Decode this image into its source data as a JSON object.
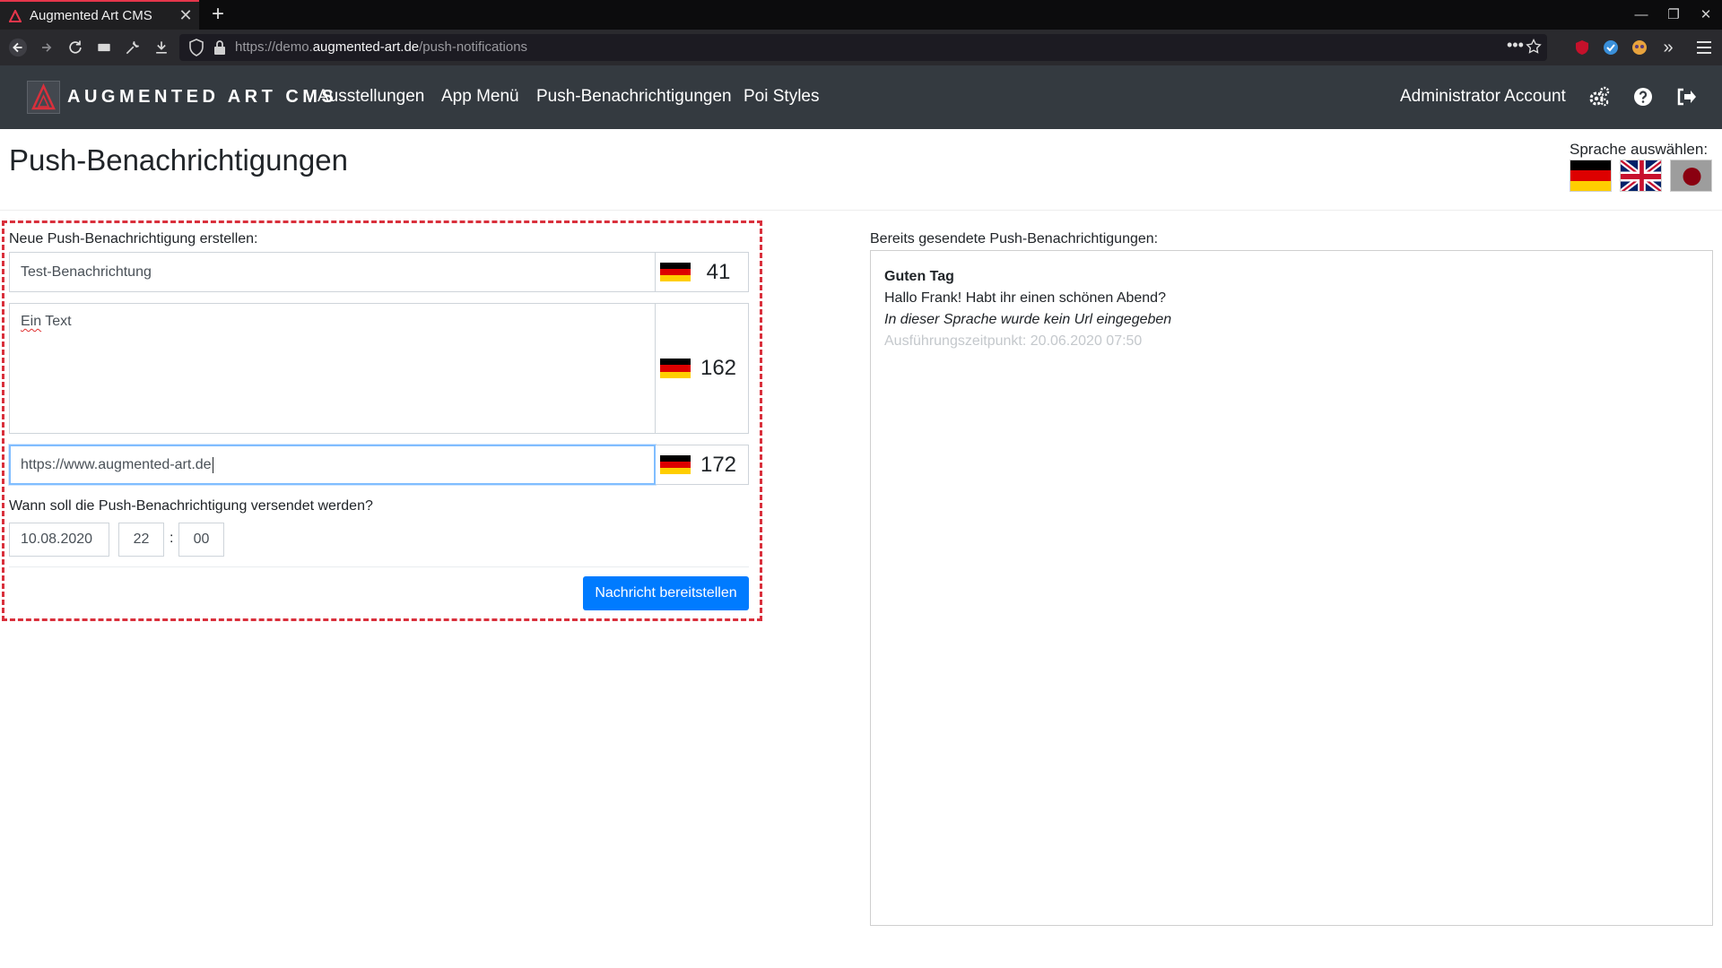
{
  "browser": {
    "tab_title": "Augmented Art CMS",
    "url_prefix": "https://demo.",
    "url_host": "augmented-art.de",
    "url_path": "/push-notifications"
  },
  "app": {
    "brand": "AUGMENTED ART CMS",
    "nav": [
      "Ausstellungen",
      "App Menü",
      "Push-Benachrichtigungen",
      "Poi Styles"
    ],
    "account": "Administrator Account"
  },
  "page": {
    "title": "Push-Benachrichtigungen",
    "language_label": "Sprache auswählen:"
  },
  "form": {
    "heading": "Neue Push-Benachrichtigung erstellen:",
    "title_value": "Test-Benachrichtung",
    "title_count": "41",
    "body_value_misspelled": "Ein",
    "body_value_rest": " Text",
    "body_count": "162",
    "url_value": "https://www.augmented-art.de",
    "url_count": "172",
    "when_label": "Wann soll die Push-Benachrichtigung versendet werden?",
    "date": "10.08.2020",
    "hour": "22",
    "time_separator": ":",
    "minute": "00",
    "submit_label": "Nachricht bereitstellen"
  },
  "sent": {
    "heading": "Bereits gesendete Push-Benachrichtigungen:",
    "items": [
      {
        "title": "Guten Tag",
        "body": "Hallo Frank! Habt ihr einen schönen Abend?",
        "url_note": "In dieser Sprache wurde kein Url eingegeben",
        "time": "Ausführungszeitpunkt: 20.06.2020 07:50"
      }
    ]
  },
  "colors": {
    "app_nav_bg": "#343a40",
    "primary": "#007bff",
    "dashed_highlight": "#d9303c",
    "focus_border": "#80bdff"
  },
  "icons": {
    "tab_favicon": "augmented-art-logo-icon",
    "tab_close": "close-icon",
    "new_tab": "plus-icon",
    "browser_nav": [
      "back-arrow-icon",
      "forward-arrow-icon",
      "reload-icon",
      "screenshot-icon",
      "wrench-icon",
      "download-icon"
    ],
    "url_bar": [
      "shield-icon",
      "lock-icon",
      "more-icon",
      "star-icon"
    ],
    "extensions": [
      "ublock-icon",
      "extension-blue-icon",
      "extension-mask-icon",
      "overflow-chevron-icon",
      "hamburger-menu-icon"
    ],
    "app_nav": [
      "settings-gears-icon",
      "help-icon",
      "logout-icon"
    ],
    "language_flags": [
      "flag-de-icon",
      "flag-uk-icon",
      "flag-jp-icon"
    ]
  }
}
